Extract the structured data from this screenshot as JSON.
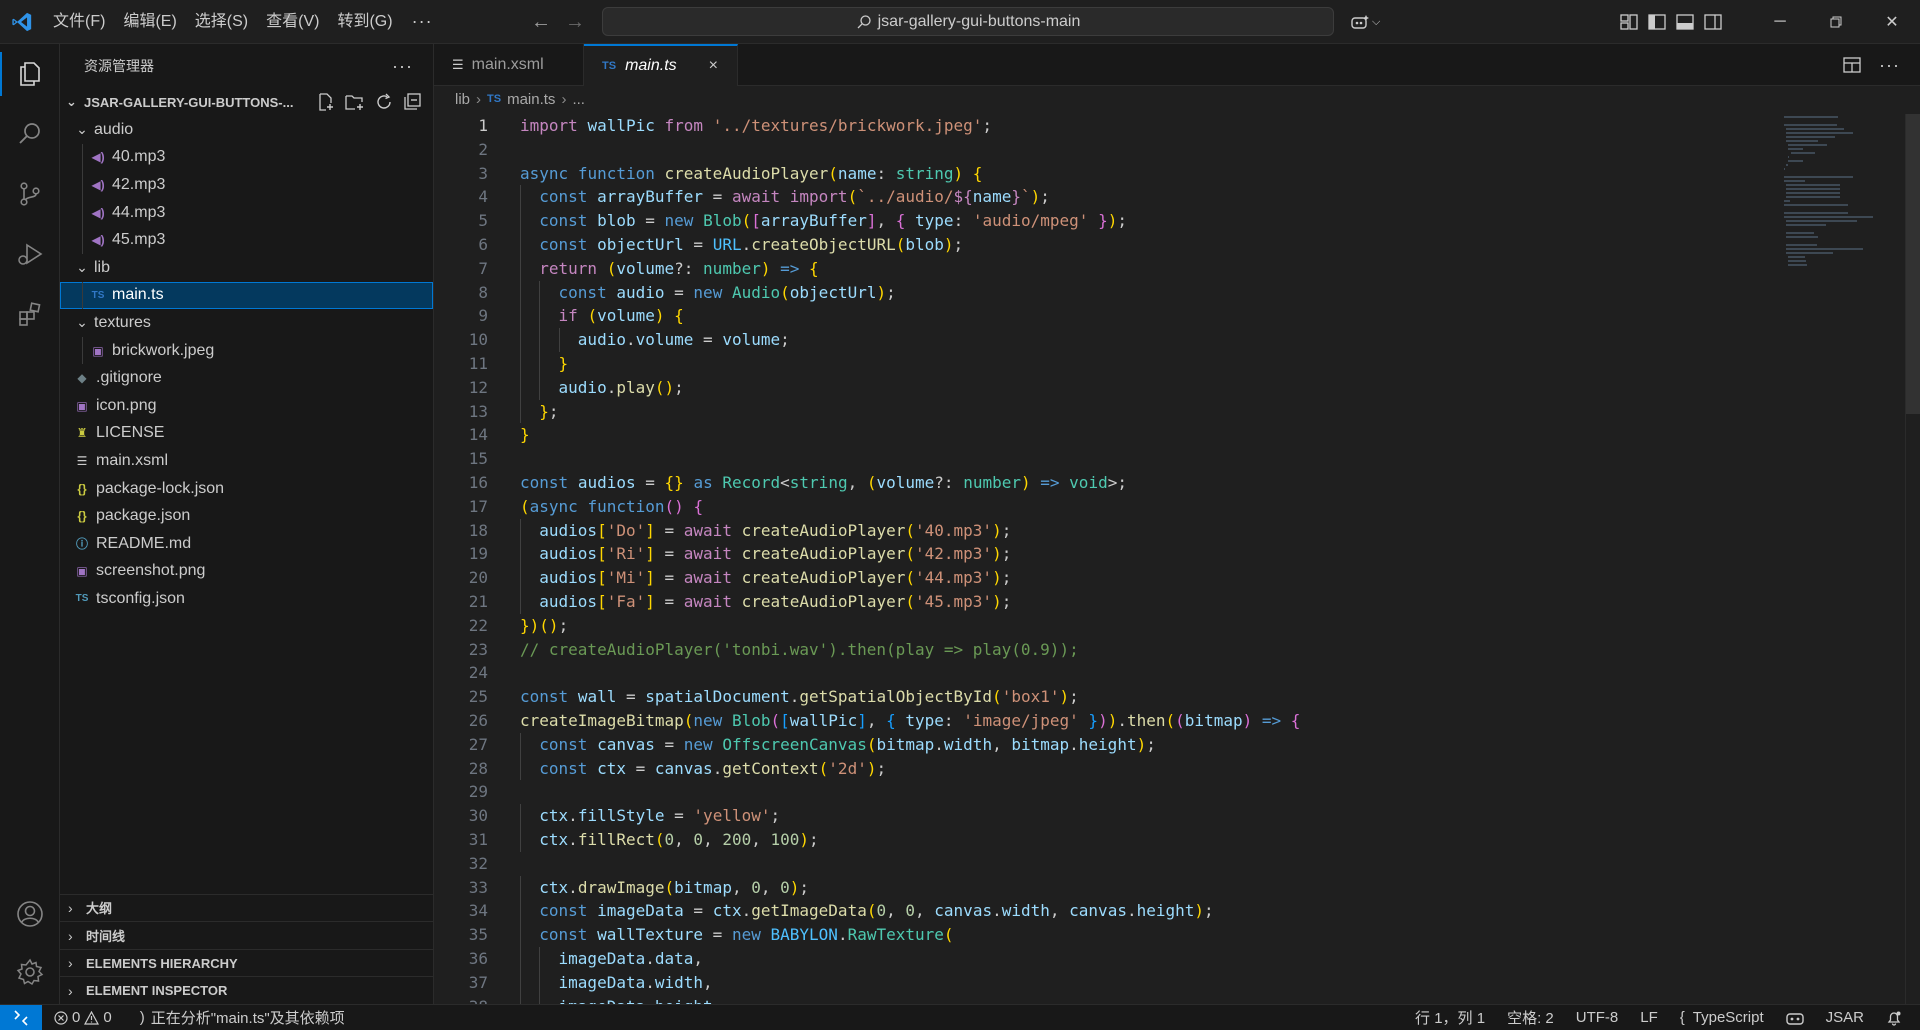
{
  "titlebar": {
    "menu": [
      "文件(F)",
      "编辑(E)",
      "选择(S)",
      "查看(V)",
      "转到(G)"
    ],
    "more": "···",
    "search_text": "jsar-gallery-gui-buttons-main"
  },
  "sidebar": {
    "title": "资源管理器",
    "more": "···",
    "project": "JSAR-GALLERY-GUI-BUTTONS-...",
    "tree": [
      {
        "label": "audio",
        "type": "folder",
        "depth": 1,
        "expanded": true
      },
      {
        "label": "40.mp3",
        "type": "audio",
        "depth": 2
      },
      {
        "label": "42.mp3",
        "type": "audio",
        "depth": 2
      },
      {
        "label": "44.mp3",
        "type": "audio",
        "depth": 2
      },
      {
        "label": "45.mp3",
        "type": "audio",
        "depth": 2
      },
      {
        "label": "lib",
        "type": "folder",
        "depth": 1,
        "expanded": true
      },
      {
        "label": "main.ts",
        "type": "ts",
        "depth": 2,
        "selected": true
      },
      {
        "label": "textures",
        "type": "folder",
        "depth": 1,
        "expanded": true
      },
      {
        "label": "brickwork.jpeg",
        "type": "image",
        "depth": 2
      },
      {
        "label": ".gitignore",
        "type": "git",
        "depth": 1
      },
      {
        "label": "icon.png",
        "type": "image",
        "depth": 1
      },
      {
        "label": "LICENSE",
        "type": "license",
        "depth": 1
      },
      {
        "label": "main.xsml",
        "type": "xml",
        "depth": 1
      },
      {
        "label": "package-lock.json",
        "type": "json",
        "depth": 1
      },
      {
        "label": "package.json",
        "type": "json",
        "depth": 1
      },
      {
        "label": "README.md",
        "type": "info",
        "depth": 1
      },
      {
        "label": "screenshot.png",
        "type": "image",
        "depth": 1
      },
      {
        "label": "tsconfig.json",
        "type": "tsconfig",
        "depth": 1
      }
    ],
    "sections": [
      "大纲",
      "时间线",
      "ELEMENTS HIERARCHY",
      "ELEMENT INSPECTOR"
    ]
  },
  "editor": {
    "tabs": [
      {
        "label": "main.xsml",
        "active": false
      },
      {
        "label": "main.ts",
        "active": true,
        "badge": "TS",
        "close": "×"
      }
    ],
    "breadcrumbs": [
      "lib",
      "main.ts",
      "..."
    ],
    "breadcrumb_badge": "TS",
    "current_line": 1,
    "lines": [
      "import wallPic from '../textures/brickwork.jpeg';",
      "",
      "async function createAudioPlayer(name: string) {",
      "  const arrayBuffer = await import(`../audio/${name}`);",
      "  const blob = new Blob([arrayBuffer], { type: 'audio/mpeg' });",
      "  const objectUrl = URL.createObjectURL(blob);",
      "  return (volume?: number) => {",
      "    const audio = new Audio(objectUrl);",
      "    if (volume) {",
      "      audio.volume = volume;",
      "    }",
      "    audio.play();",
      "  };",
      "}",
      "",
      "const audios = {} as Record<string, (volume?: number) => void>;",
      "(async function() {",
      "  audios['Do'] = await createAudioPlayer('40.mp3');",
      "  audios['Ri'] = await createAudioPlayer('42.mp3');",
      "  audios['Mi'] = await createAudioPlayer('44.mp3');",
      "  audios['Fa'] = await createAudioPlayer('45.mp3');",
      "})();",
      "// createAudioPlayer('tonbi.wav').then(play => play(0.9));",
      "",
      "const wall = spatialDocument.getSpatialObjectById('box1');",
      "createImageBitmap(new Blob([wallPic], { type: 'image/jpeg' })).then((bitmap) => {",
      "  const canvas = new OffscreenCanvas(bitmap.width, bitmap.height);",
      "  const ctx = canvas.getContext('2d');",
      "",
      "  ctx.fillStyle = 'yellow';",
      "  ctx.fillRect(0, 0, 200, 100);",
      "",
      "  ctx.drawImage(bitmap, 0, 0);",
      "  const imageData = ctx.getImageData(0, 0, canvas.width, canvas.height);",
      "  const wallTexture = new BABYLON.RawTexture(",
      "    imageData.data,",
      "    imageData.width,",
      "    imageData.height,"
    ]
  },
  "statusbar": {
    "errors": "0",
    "warnings": "0",
    "message": "正在分析\"main.ts\"及其依赖项",
    "position": "行 1，列 1",
    "spaces": "空格: 2",
    "encoding": "UTF-8",
    "eol": "LF",
    "language": "TypeScript",
    "extension": "JSAR"
  },
  "colors": {
    "accent": "#0078d4",
    "background": "#1f1f1f",
    "sidebar": "#181818",
    "selection": "#04395e"
  }
}
